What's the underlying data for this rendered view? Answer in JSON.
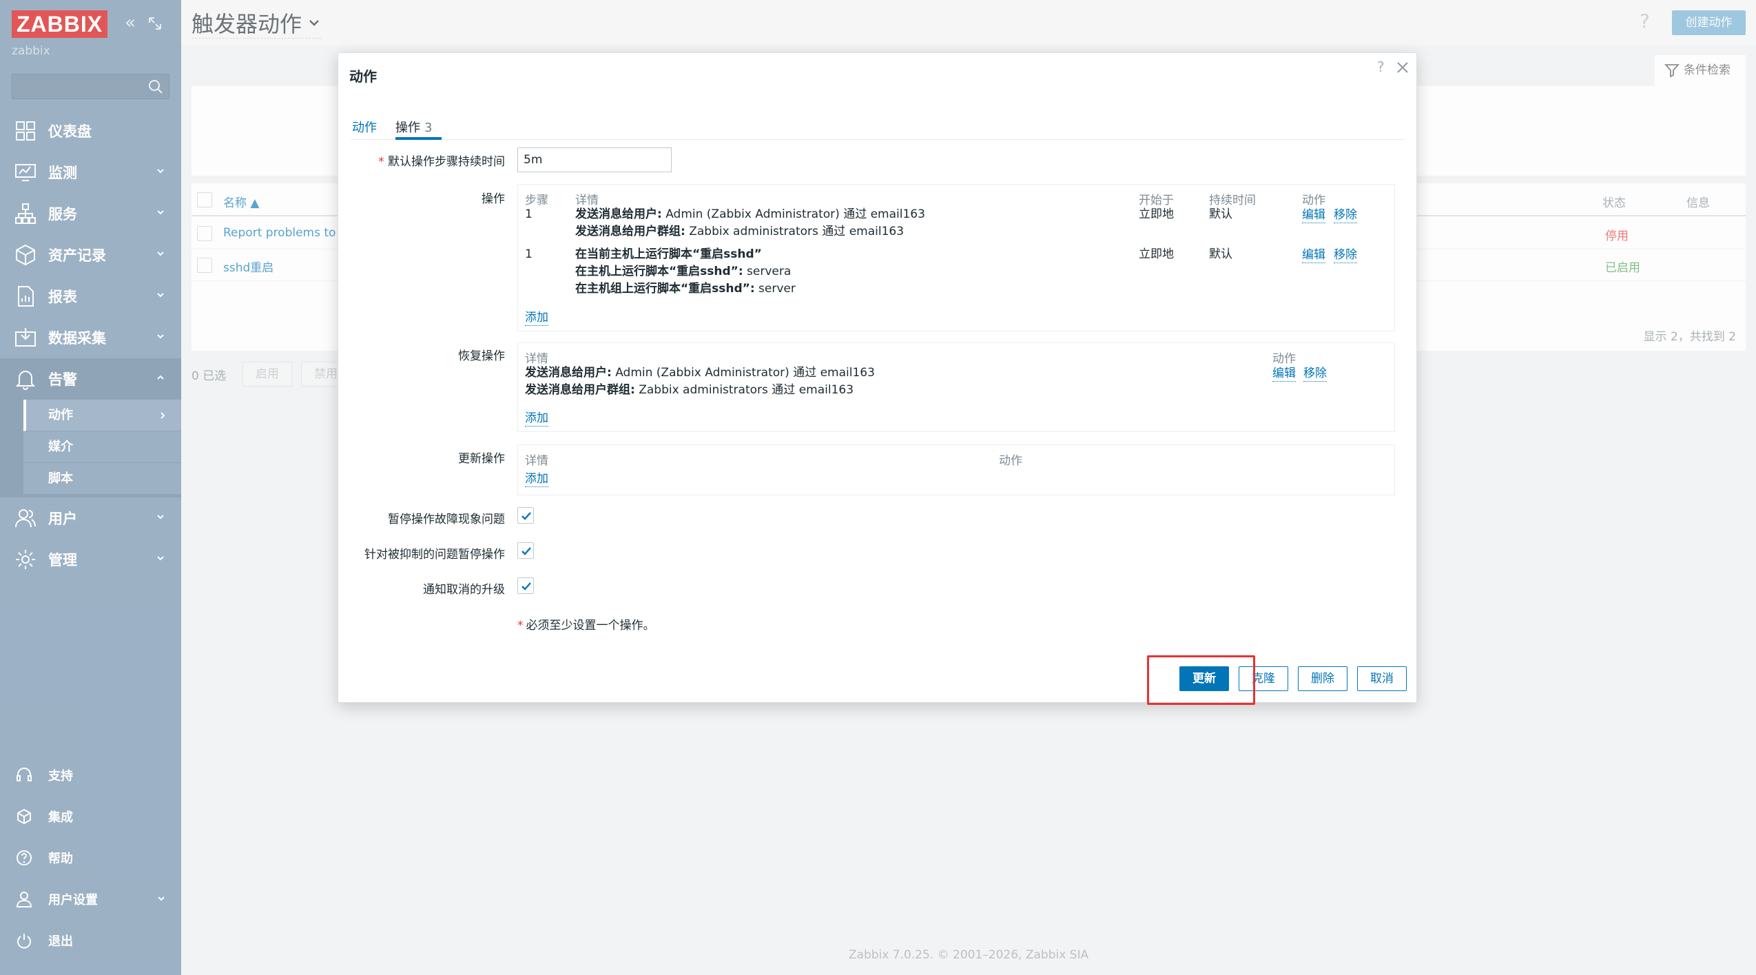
{
  "sidebar": {
    "logo": "ZABBIX",
    "server_name": "zabbix",
    "search_placeholder": "",
    "menu": [
      {
        "label": "仪表盘",
        "icon": "dashboard-icon"
      },
      {
        "label": "监测",
        "icon": "monitoring-icon"
      },
      {
        "label": "服务",
        "icon": "services-icon"
      },
      {
        "label": "资产记录",
        "icon": "inventory-icon"
      },
      {
        "label": "报表",
        "icon": "reports-icon"
      },
      {
        "label": "数据采集",
        "icon": "data-collection-icon"
      },
      {
        "label": "告警",
        "icon": "alerts-icon"
      },
      {
        "label": "用户",
        "icon": "users-icon"
      },
      {
        "label": "管理",
        "icon": "administration-icon"
      }
    ],
    "alerts_submenu": [
      "动作",
      "媒介",
      "脚本"
    ],
    "bottom": [
      {
        "label": "支持",
        "icon": "support-icon"
      },
      {
        "label": "集成",
        "icon": "integrations-icon"
      },
      {
        "label": "帮助",
        "icon": "help-icon"
      },
      {
        "label": "用户设置",
        "icon": "user-settings-icon"
      },
      {
        "label": "退出",
        "icon": "signout-icon"
      }
    ]
  },
  "header": {
    "title": "触发器动作",
    "help": "?",
    "create_button": "创建动作",
    "filter_tab": "条件检索"
  },
  "list": {
    "col_name": "名称 ▲",
    "col_status": "状态",
    "col_info": "信息",
    "rows": [
      {
        "name": "Report problems to Z",
        "status": "停用"
      },
      {
        "name": "sshd重启",
        "status": "已启用"
      }
    ],
    "footer": "显示 2，共找到 2",
    "selected": "0 已选",
    "enable_btn": "启用",
    "disable_btn": "禁用"
  },
  "modal": {
    "title": "动作",
    "help": "?",
    "tabs": {
      "action": "动作",
      "ops": "操作",
      "ops_count": "3"
    },
    "default_duration_label": "默认操作步骤持续时间",
    "default_duration_value": "5m",
    "operations_label": "操作",
    "operations_headers": {
      "step": "步骤",
      "details": "详情",
      "start": "开始于",
      "duration": "持续时间",
      "action": "动作"
    },
    "operations": [
      {
        "step": "1",
        "lines": [
          {
            "bold": "发送消息给用户:",
            "text": " Admin (Zabbix Administrator) 通过 email163"
          },
          {
            "bold": "发送消息给用户群组:",
            "text": " Zabbix administrators 通过 email163"
          }
        ],
        "start": "立即地",
        "duration": "默认"
      },
      {
        "step": "1",
        "lines": [
          {
            "bold": "在当前主机上运行脚本“重启sshd”",
            "text": ""
          },
          {
            "bold": "在主机上运行脚本“重启sshd”:",
            "text": " servera"
          },
          {
            "bold": "在主机组上运行脚本“重启sshd”:",
            "text": " server"
          }
        ],
        "start": "立即地",
        "duration": "默认"
      }
    ],
    "edit": "编辑",
    "remove": "移除",
    "add": "添加",
    "recovery_label": "恢复操作",
    "recovery_headers": {
      "details": "详情",
      "action": "动作"
    },
    "recovery_lines": [
      {
        "bold": "发送消息给用户:",
        "text": " Admin (Zabbix Administrator) 通过 email163"
      },
      {
        "bold": "发送消息给用户群组:",
        "text": " Zabbix administrators 通过 email163"
      }
    ],
    "update_label": "更新操作",
    "update_headers": {
      "details": "详情",
      "action": "动作"
    },
    "pause_symptoms_label": "暂停操作故障现象问题",
    "pause_suppressed_label": "针对被抑制的问题暂停操作",
    "notify_cancel_label": "通知取消的升级",
    "checks": {
      "pause_symptoms": true,
      "pause_suppressed": true,
      "notify_cancel": true
    },
    "required_note": "必须至少设置一个操作。",
    "buttons": {
      "update": "更新",
      "clone": "克隆",
      "delete": "删除",
      "cancel": "取消"
    }
  },
  "footer": "Zabbix 7.0.25. © 2001–2026, Zabbix SIA",
  "colors": {
    "sidebar": "#6a8aa8",
    "primary": "#0275b8",
    "logo": "#d40000",
    "highlight": "#e53333"
  }
}
